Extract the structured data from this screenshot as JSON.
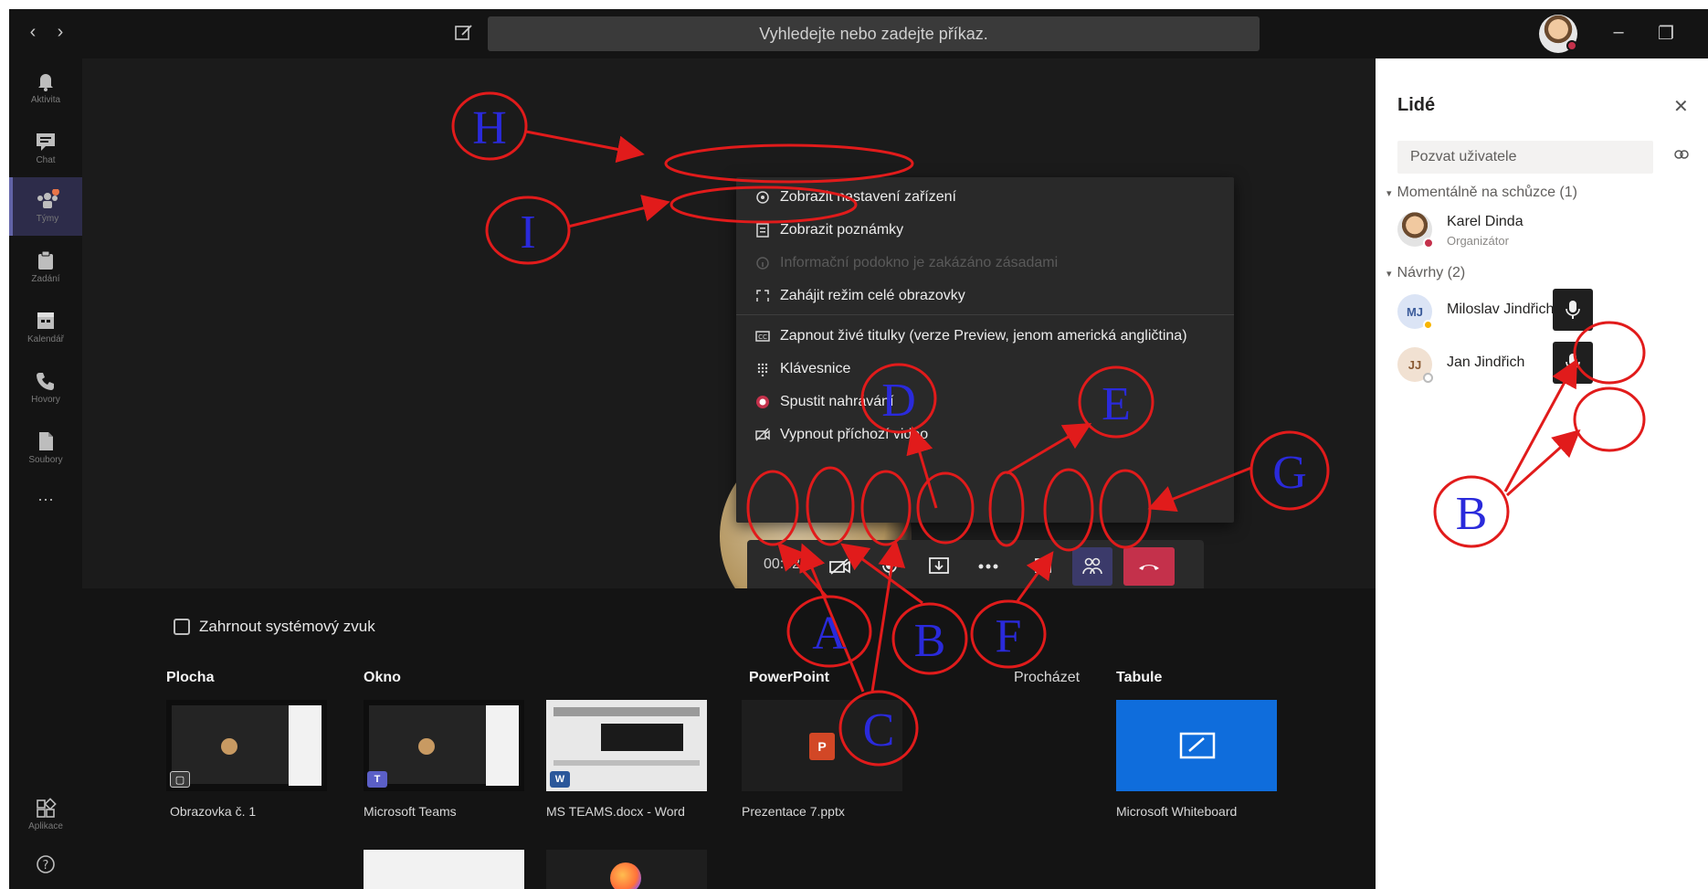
{
  "titlebar": {
    "back": "‹",
    "forward": "›",
    "search_placeholder": "Vyhledejte nebo zadejte příkaz.",
    "minimize": "–",
    "maximize": "❐"
  },
  "rail": {
    "items": [
      {
        "label": "Aktivita",
        "icon": "bell-icon"
      },
      {
        "label": "Chat",
        "icon": "chat-icon"
      },
      {
        "label": "Týmy",
        "icon": "teams-icon"
      },
      {
        "label": "Zadání",
        "icon": "assignments-icon"
      },
      {
        "label": "Kalendář",
        "icon": "calendar-icon"
      },
      {
        "label": "Hovory",
        "icon": "phone-icon"
      },
      {
        "label": "Soubory",
        "icon": "files-icon"
      }
    ],
    "more": "···",
    "apps_label": "Aplikace"
  },
  "menu": {
    "items": [
      {
        "label": "Zobrazit nastavení zařízení",
        "icon": "settings-icon",
        "enabled": true
      },
      {
        "label": "Zobrazit poznámky",
        "icon": "notes-icon",
        "enabled": true
      },
      {
        "label": "Informační podokno je zakázáno zásadami",
        "icon": "info-icon",
        "enabled": false
      },
      {
        "label": "Zahájit režim celé obrazovky",
        "icon": "fullscreen-icon",
        "enabled": true
      },
      {
        "label": "Zapnout živé titulky (verze Preview, jenom americká angličtina)",
        "icon": "captions-icon",
        "enabled": true
      },
      {
        "label": "Klávesnice",
        "icon": "keypad-icon",
        "enabled": true
      },
      {
        "label": "Spustit nahrávání",
        "icon": "record-icon",
        "enabled": true
      },
      {
        "label": "Vypnout příchozí video",
        "icon": "video-off-icon",
        "enabled": true
      }
    ]
  },
  "controls": {
    "timer": "00:32"
  },
  "share": {
    "include_system_audio": "Zahrnout systémový zvuk",
    "sections": {
      "desktop": "Plocha",
      "window": "Okno",
      "powerpoint": "PowerPoint",
      "browse": "Procházet",
      "whiteboard": "Tabule"
    },
    "items": {
      "screen1": "Obrazovka č. 1",
      "teams": "Microsoft Teams",
      "word": "MS TEAMS.docx - Word",
      "pptx": "Prezentace 7.pptx",
      "whiteboard": "Microsoft Whiteboard"
    }
  },
  "people": {
    "title": "Lidé",
    "invite_placeholder": "Pozvat uživatele",
    "in_meeting_header": "Momentálně na schůzce (1)",
    "suggestions_header": "Návrhy (2)",
    "in_meeting": [
      {
        "name": "Karel Dinda",
        "role": "Organizátor"
      }
    ],
    "suggestions": [
      {
        "initials": "MJ",
        "name": "Miloslav Jindřich"
      },
      {
        "initials": "JJ",
        "name": "Jan Jindřich"
      }
    ]
  },
  "annotations": {
    "labels": [
      "A",
      "B",
      "C",
      "D",
      "E",
      "F",
      "G",
      "H",
      "I",
      "B"
    ],
    "color": "#e11b1b",
    "text_color": "#2a2adb"
  },
  "colors": {
    "accent": "#6264a7",
    "hangup": "#c4314b",
    "whiteboard": "#0f6ddc"
  }
}
